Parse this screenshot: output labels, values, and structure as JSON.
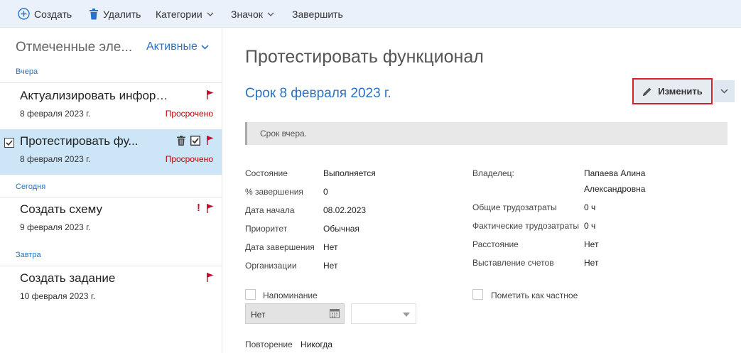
{
  "toolbar": {
    "create": "Создать",
    "delete": "Удалить",
    "categories": "Категории",
    "badge": "Значок",
    "complete": "Завершить"
  },
  "list": {
    "title": "Отмеченные эле...",
    "filter": "Активные",
    "groups": [
      {
        "label": "Вчера",
        "tasks": [
          {
            "title": "Актуализировать информа...",
            "date": "8 февраля 2023 г.",
            "status": "Просрочено"
          },
          {
            "title": "Протестировать фу...",
            "date": "8 февраля 2023 г.",
            "status": "Просрочено",
            "selected": true
          }
        ]
      },
      {
        "label": "Сегодня",
        "tasks": [
          {
            "title": "Создать схему",
            "date": "9 февраля 2023 г.",
            "status": "",
            "important": "!"
          }
        ]
      },
      {
        "label": "Завтра",
        "tasks": [
          {
            "title": "Создать задание",
            "date": "10 февраля 2023 г.",
            "status": ""
          }
        ]
      }
    ]
  },
  "detail": {
    "title": "Протестировать функционал",
    "due": "Срок 8 февраля 2023 г.",
    "edit_label": "Изменить",
    "notice": "Срок вчера.",
    "fields_left": [
      {
        "label": "Состояние",
        "value": "Выполняется"
      },
      {
        "label": "% завершения",
        "value": "0"
      },
      {
        "label": "Дата начала",
        "value": "08.02.2023"
      },
      {
        "label": "Приоритет",
        "value": "Обычная"
      },
      {
        "label": "Дата завершения",
        "value": "Нет"
      },
      {
        "label": "Организации",
        "value": "Нет"
      }
    ],
    "owner": {
      "label": "Владелец:",
      "value_line1": "Папаева Алина",
      "value_line2": "Александровна"
    },
    "fields_right": [
      {
        "label": "Общие трудозатраты",
        "value": "0 ч"
      },
      {
        "label": "Фактические трудозатраты",
        "value": "0 ч"
      },
      {
        "label": "Расстояние",
        "value": "Нет"
      },
      {
        "label": "Выставление счетов",
        "value": "Нет"
      }
    ],
    "reminder_label": "Напоминание",
    "private_label": "Пометить как частное",
    "reminder_date": "Нет",
    "recurrence_label": "Повторение",
    "recurrence_value": "Никогда"
  },
  "colors": {
    "accent": "#2a72c4",
    "overdue": "#c00000",
    "flag": "#c8102e",
    "selected_bg": "#cde6f7",
    "toolbar_bg": "#eaf1fa",
    "edit_border": "#d9202a"
  }
}
